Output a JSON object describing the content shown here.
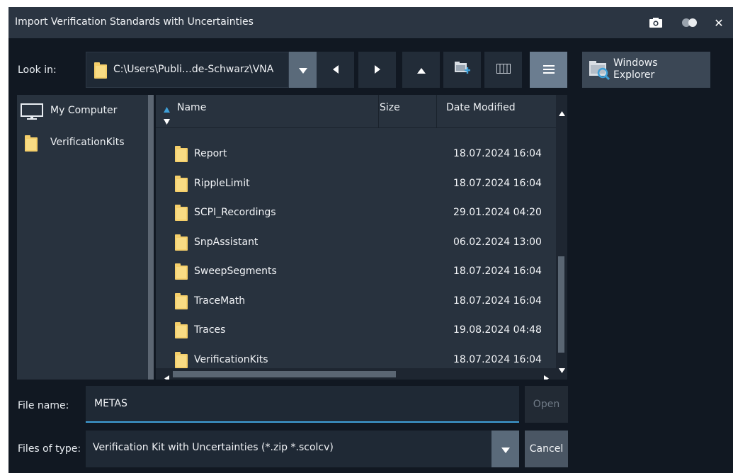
{
  "window": {
    "title": "Import Verification Standards with Uncertainties",
    "buttons": {
      "screenshot_icon": "camera-icon",
      "toggle_icon": "toggle-icon",
      "close": "✕"
    }
  },
  "toolbar": {
    "look_in_label": "Look in:",
    "path": "C:\\Users\\Publi…de-Schwarz\\VNA",
    "nav_icons": [
      "back-icon",
      "forward-icon",
      "up-icon",
      "new-folder-icon",
      "grid-view-icon",
      "list-view-icon"
    ],
    "windows_explorer_line1": "Windows",
    "windows_explorer_line2": "Explorer"
  },
  "sidebar": {
    "items": [
      {
        "label": "My Computer",
        "icon": "monitor-icon"
      },
      {
        "label": "VerificationKits",
        "icon": "folder-icon"
      }
    ]
  },
  "file_list": {
    "columns": {
      "name": "Name",
      "size": "Size",
      "date": "Date Modified"
    },
    "rows": [
      {
        "name": "Report",
        "size": "",
        "date": "18.07.2024 16:04"
      },
      {
        "name": "RippleLimit",
        "size": "",
        "date": "18.07.2024 16:04"
      },
      {
        "name": "SCPI_Recordings",
        "size": "",
        "date": "29.01.2024 04:20"
      },
      {
        "name": "SnpAssistant",
        "size": "",
        "date": "06.02.2024 13:00"
      },
      {
        "name": "SweepSegments",
        "size": "",
        "date": "18.07.2024 16:04"
      },
      {
        "name": "TraceMath",
        "size": "",
        "date": "18.07.2024 16:04"
      },
      {
        "name": "Traces",
        "size": "",
        "date": "19.08.2024 04:48"
      },
      {
        "name": "VerificationKits",
        "size": "",
        "date": "18.07.2024 16:04"
      }
    ]
  },
  "bottom": {
    "file_name_label": "File name:",
    "file_name_value": "METAS",
    "open_label": "Open",
    "files_of_type_label": "Files of type:",
    "files_of_type_value": "Verification Kit with Uncertainties (*.zip *.scolcv)",
    "cancel_label": "Cancel"
  },
  "colors": {
    "background": "#111822",
    "titlebar": "#2b3542",
    "panel": "#28323e",
    "accent": "#3fa0d8",
    "folder": "#f5cf6a"
  }
}
